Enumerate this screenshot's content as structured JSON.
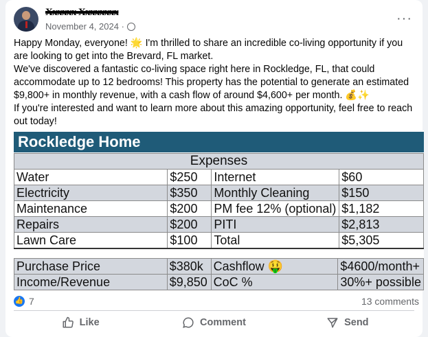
{
  "post": {
    "author": "Xxxxxx Xxxxxxxx",
    "date": "November 4, 2024 ·",
    "more": "···",
    "lines": [
      "Happy Monday, everyone! 🌟 I'm thrilled to share an incredible co-living opportunity if you are looking to get into the Brevard, FL market.",
      "We've discovered a fantastic co-living space right here in Rockledge, FL, that could accommodate up to 12 bedrooms! This property has the potential to generate an estimated $9,800+ in monthly revenue, with a cash flow of around $4,600+ per month. 💰✨",
      "If you're interested and want to learn more about this amazing opportunity, feel free to reach out today!"
    ]
  },
  "table": {
    "banner": "Rockledge Home",
    "expenses_title": "Expenses",
    "rows": [
      [
        "Water",
        "$250",
        "Internet",
        "$60"
      ],
      [
        "Electricity",
        "$350",
        "Monthly Cleaning",
        "$150"
      ],
      [
        "Maintenance",
        "$200",
        "PM fee 12% (optional)",
        "$1,182"
      ],
      [
        "Repairs",
        "$200",
        "PITI",
        "$2,813"
      ],
      [
        "Lawn Care",
        "$100",
        "Total",
        "$5,305"
      ]
    ],
    "summary": [
      [
        "Purchase Price",
        "$380k",
        "Cashflow 🤑",
        "$4600/month+"
      ],
      [
        "Income/Revenue",
        "$9,850",
        "CoC %",
        "30%+ possible"
      ]
    ]
  },
  "stats": {
    "likes": "7",
    "comments": "13 comments",
    "like_icon": "thumbs-up-icon"
  },
  "actions": {
    "like": "Like",
    "comment": "Comment",
    "send": "Send"
  },
  "colors": {
    "banner": "#1f5b78",
    "row_shade": "#d3d7de",
    "like_blue": "#1877f2"
  }
}
